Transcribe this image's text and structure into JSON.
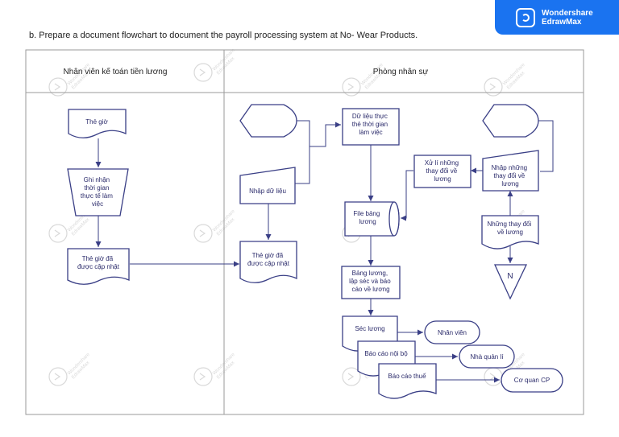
{
  "title": "b. Prepare a document flowchart to document the payroll processing system at No- Wear Products.",
  "brand": {
    "line1": "Wondershare",
    "line2": "EdrawMax",
    "color": "#1a73f0"
  },
  "watermark": {
    "line1": "Wondershare",
    "line2": "EdrawMax"
  },
  "lanes": {
    "left": "Nhân viên kế toán tiền lương",
    "right": "Phòng nhân sự"
  },
  "nodes": {
    "the_gio": [
      "Thẻ giờ"
    ],
    "ghi_nhan": [
      "Ghi nhận",
      "thời gian",
      "thực tế làm",
      "việc"
    ],
    "the_gio_cap_nhat_1": [
      "Thẻ giờ đã",
      "được cập nhật"
    ],
    "the_gio_cap_nhat_2": [
      "Thẻ giờ đã",
      "được cập nhật"
    ],
    "nhap_du_lieu": [
      "Nhập dữ liệu"
    ],
    "du_lieu_thuc": [
      "Dữ liệu thực",
      "thẻ thời gian",
      "làm việc"
    ],
    "file_bang_luong": [
      "File bảng",
      "lương"
    ],
    "bang_luong": [
      "Bảng lương,",
      "lập séc và báo",
      "cáo về lương"
    ],
    "xu_li": [
      "Xử lí những",
      "thay đổi về",
      "lương"
    ],
    "nhap_nhung": [
      "Nhập những",
      "thay đổi về",
      "lương"
    ],
    "nhung_thay_doi": [
      "Những thay đổi",
      "về lương"
    ],
    "n_node": [
      "N"
    ],
    "sec_luong": [
      "Séc lương"
    ],
    "bao_cao_noi_bo": [
      "Báo cáo nội bộ"
    ],
    "bao_cao_thue": [
      "Báo cáo thuế"
    ],
    "nhan_vien": [
      "Nhân viên"
    ],
    "nha_quan_li": [
      "Nhà quản lí"
    ],
    "co_quan_cp": [
      "Cơ quan CP"
    ]
  }
}
